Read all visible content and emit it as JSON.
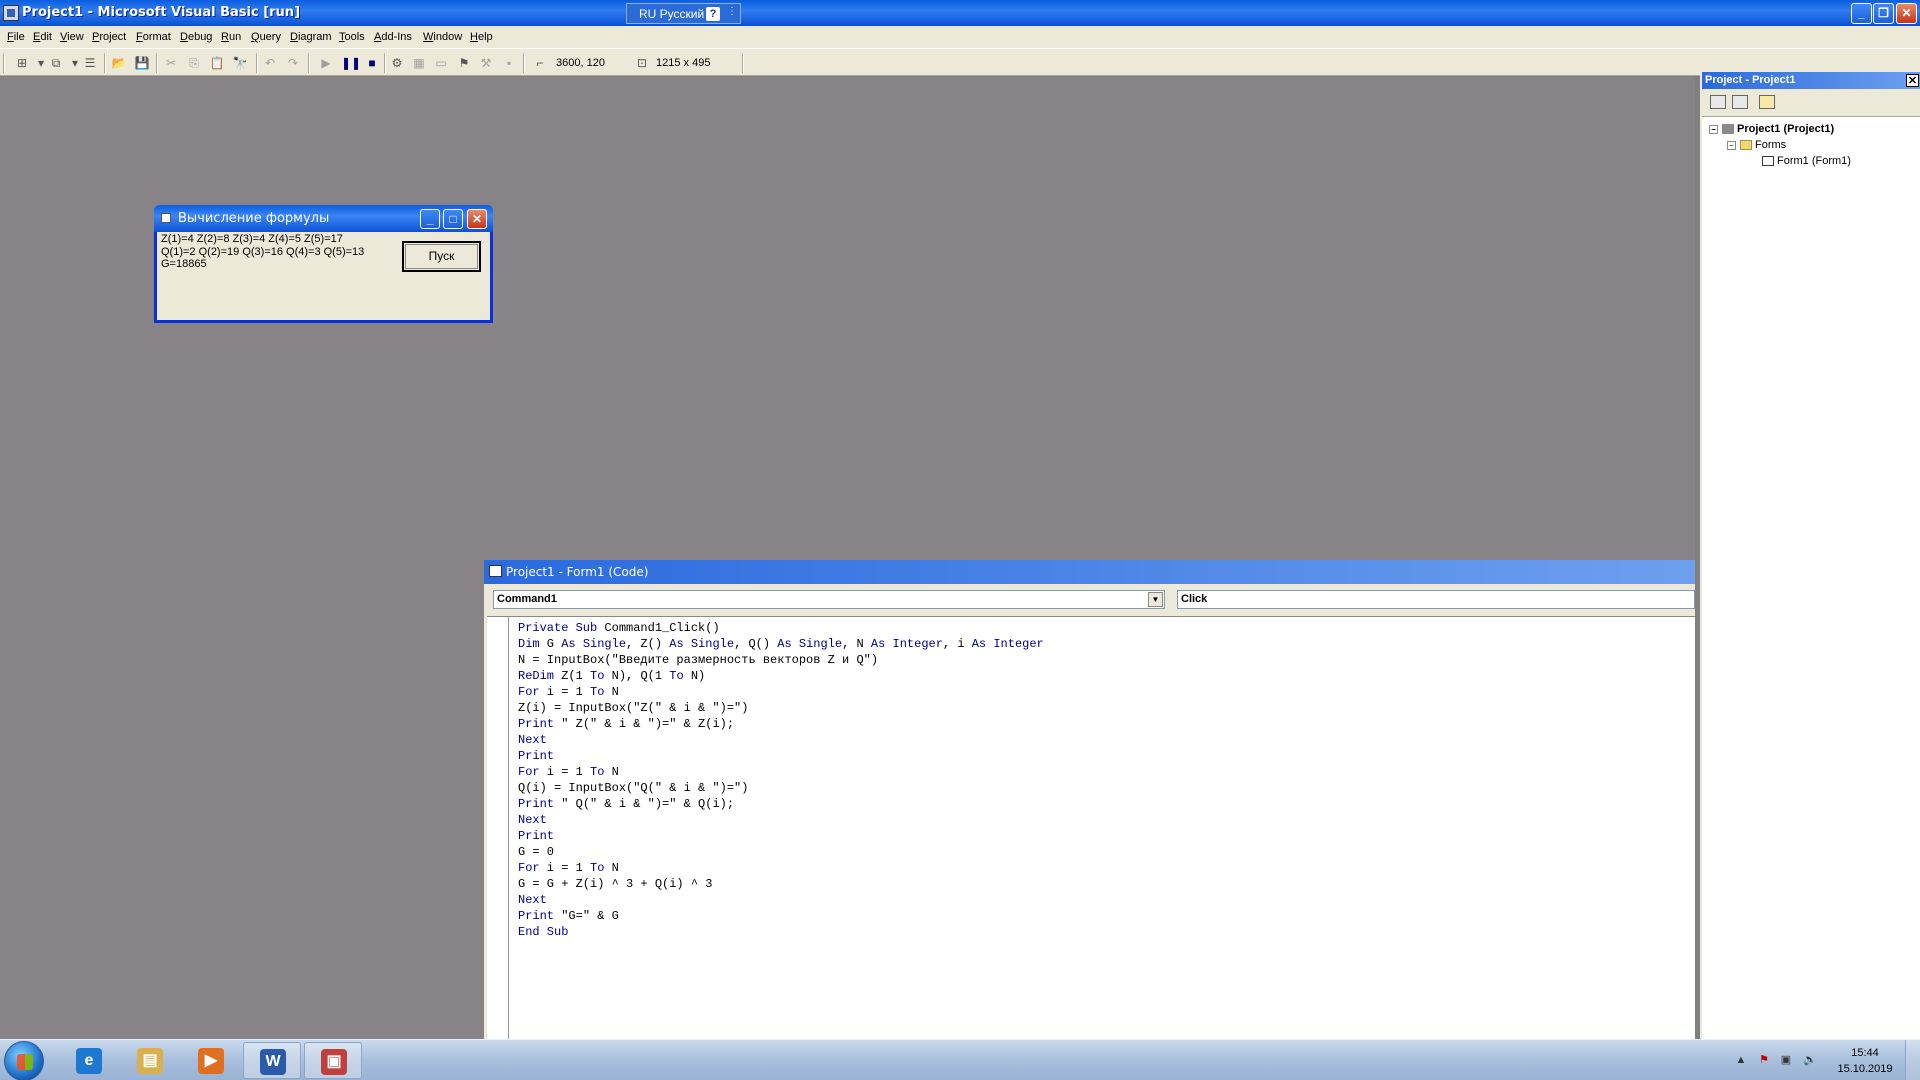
{
  "window": {
    "title": "Project1 - Microsoft Visual Basic [run]",
    "language": "RU Русский",
    "lang_help": "?"
  },
  "menu": [
    "File",
    "Edit",
    "View",
    "Project",
    "Format",
    "Debug",
    "Run",
    "Query",
    "Diagram",
    "Tools",
    "Add-Ins",
    "Window",
    "Help"
  ],
  "toolbar": {
    "position": "3600, 120",
    "size": "1215 x 495"
  },
  "form": {
    "title": "Вычисление формулы",
    "output": [
      "Z(1)=4 Z(2)=8 Z(3)=4 Z(4)=5 Z(5)=17",
      "Q(1)=2 Q(2)=19 Q(3)=16 Q(4)=3 Q(5)=13",
      "G=18865"
    ],
    "button_label": "Пуск"
  },
  "code_window": {
    "title": "Project1 - Form1 (Code)",
    "object": "Command1",
    "procedure": "Click",
    "lines": [
      [
        [
          "kw",
          "Private Sub"
        ],
        [
          "tx",
          " Command1_Click()"
        ]
      ],
      [
        [
          "kw",
          "Dim"
        ],
        [
          "tx",
          " G "
        ],
        [
          "kw",
          "As Single"
        ],
        [
          "tx",
          ", Z() "
        ],
        [
          "kw",
          "As Single"
        ],
        [
          "tx",
          ", Q() "
        ],
        [
          "kw",
          "As Single"
        ],
        [
          "tx",
          ", N "
        ],
        [
          "kw",
          "As Integer"
        ],
        [
          "tx",
          ", i "
        ],
        [
          "kw",
          "As Integer"
        ]
      ],
      [
        [
          "tx",
          "N = InputBox(\"Введите размерность векторов Z и Q\")"
        ]
      ],
      [
        [
          "kw",
          "ReDim"
        ],
        [
          "tx",
          " Z(1 "
        ],
        [
          "kw",
          "To"
        ],
        [
          "tx",
          " N), Q(1 "
        ],
        [
          "kw",
          "To"
        ],
        [
          "tx",
          " N)"
        ]
      ],
      [
        [
          "kw",
          "For"
        ],
        [
          "tx",
          " i = 1 "
        ],
        [
          "kw",
          "To"
        ],
        [
          "tx",
          " N"
        ]
      ],
      [
        [
          "tx",
          "Z(i) = InputBox(\"Z(\" & i & \")=\")"
        ]
      ],
      [
        [
          "kw",
          "Print"
        ],
        [
          "tx",
          " \" Z(\" & i & \")=\" & Z(i);"
        ]
      ],
      [
        [
          "kw",
          "Next"
        ]
      ],
      [
        [
          "kw",
          "Print"
        ]
      ],
      [
        [
          "kw",
          "For"
        ],
        [
          "tx",
          " i = 1 "
        ],
        [
          "kw",
          "To"
        ],
        [
          "tx",
          " N"
        ]
      ],
      [
        [
          "tx",
          "Q(i) = InputBox(\"Q(\" & i & \")=\")"
        ]
      ],
      [
        [
          "kw",
          "Print"
        ],
        [
          "tx",
          " \" Q(\" & i & \")=\" & Q(i);"
        ]
      ],
      [
        [
          "kw",
          "Next"
        ]
      ],
      [
        [
          "kw",
          "Print"
        ]
      ],
      [
        [
          "tx",
          "G = 0"
        ]
      ],
      [
        [
          "kw",
          "For"
        ],
        [
          "tx",
          " i = 1 "
        ],
        [
          "kw",
          "To"
        ],
        [
          "tx",
          " N"
        ]
      ],
      [
        [
          "tx",
          "G = G + Z(i) ^ 3 + Q(i) ^ 3"
        ]
      ],
      [
        [
          "kw",
          "Next"
        ]
      ],
      [
        [
          "kw",
          "Print"
        ],
        [
          "tx",
          " \"G=\" & G"
        ]
      ],
      [
        [
          "kw",
          "End Sub"
        ]
      ]
    ]
  },
  "project_explorer": {
    "title": "Project - Project1",
    "project": "Project1 (Project1)",
    "folder": "Forms",
    "form_item": "Form1 (Form1)"
  },
  "taskbar": {
    "apps": [
      {
        "icon": "ie-icon",
        "glyph": "e",
        "color": "#1e78d0",
        "open": false
      },
      {
        "icon": "explorer-icon",
        "glyph": "▤",
        "color": "#d8b050",
        "open": false
      },
      {
        "icon": "media-player-icon",
        "glyph": "▶",
        "color": "#e07020",
        "open": false
      },
      {
        "icon": "word-icon",
        "glyph": "W",
        "color": "#2a5aa8",
        "open": true
      },
      {
        "icon": "vb-icon",
        "glyph": "▣",
        "color": "#c04040",
        "open": true
      }
    ],
    "time": "15:44",
    "date": "15.10.2019"
  }
}
